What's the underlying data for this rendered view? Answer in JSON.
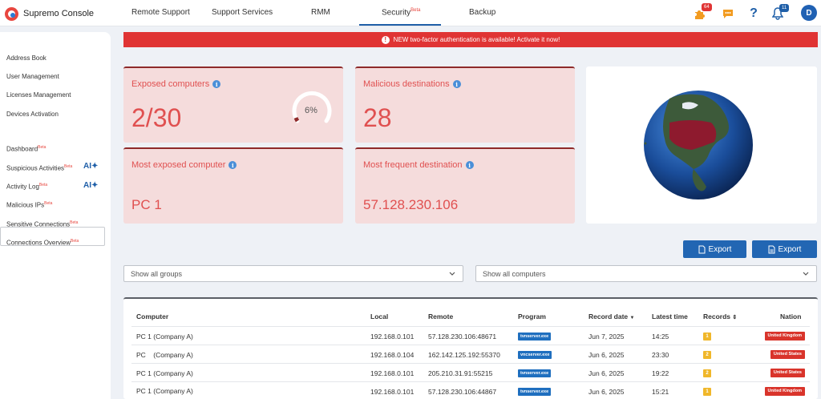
{
  "app": {
    "name": "Supremo Console"
  },
  "nav": {
    "tabs": [
      {
        "label": "Remote Support"
      },
      {
        "label": "Support Services"
      },
      {
        "label": "RMM"
      },
      {
        "label": "Security",
        "badge": "Beta"
      },
      {
        "label": "Backup"
      }
    ],
    "active": "Security"
  },
  "toolbar": {
    "addons_count": "64",
    "notifications_count": "11",
    "help": "?",
    "avatar": "D"
  },
  "sidebar": {
    "items": [
      {
        "label": "Address Book"
      },
      {
        "label": "User Management"
      },
      {
        "label": "Licenses Management"
      },
      {
        "label": "Devices Activation"
      },
      {
        "label": "Dashboard",
        "badge": "Beta"
      },
      {
        "label": "Suspicious Activities",
        "badge": "Beta",
        "ai": "AI"
      },
      {
        "label": "Activity Log",
        "badge": "Beta",
        "ai": "AI"
      },
      {
        "label": "Malicious IPs",
        "badge": "Beta"
      },
      {
        "label": "Sensitive Connections",
        "badge": "Beta"
      },
      {
        "label": "Connections Overview",
        "badge": "Beta"
      }
    ],
    "active": "Malicious IPs"
  },
  "banner": {
    "text": "NEW two-factor authentication is available! Activate it now!",
    "icon": "!"
  },
  "cards": {
    "exposed": {
      "title": "Exposed computers",
      "value": "2/30",
      "gauge_label": "6%",
      "gauge_fraction": 0.06
    },
    "malicious": {
      "title": "Malicious destinations",
      "value": "28"
    },
    "most_exposed": {
      "title": "Most exposed computer",
      "value": "PC 1"
    },
    "most_frequent": {
      "title": "Most frequent destination",
      "value": "57.128.230.106"
    }
  },
  "exports": {
    "label1": "Export",
    "label2": "Export"
  },
  "filters": {
    "groups": "Show all groups",
    "computers": "Show all computers"
  },
  "table": {
    "headers": {
      "computer": "Computer",
      "local": "Local",
      "remote": "Remote",
      "program": "Program",
      "record_date": "Record date",
      "latest_time": "Latest time",
      "records": "Records",
      "nation": "Nation"
    },
    "rows": [
      {
        "computer": "PC 1 (Company A)",
        "local": "192.168.0.101",
        "remote": "57.128.230.106:48671",
        "program": "tvnserver.exe",
        "date": "Jun 7, 2025",
        "time": "14:25",
        "records": "1",
        "nation": "United Kingdom"
      },
      {
        "computer": "PC    (Company A)",
        "local": "192.168.0.104",
        "remote": "162.142.125.192:55370",
        "program": "vncserver.exe",
        "date": "Jun 6, 2025",
        "time": "23:30",
        "records": "2",
        "nation": "United States"
      },
      {
        "computer": "PC 1 (Company A)",
        "local": "192.168.0.101",
        "remote": "205.210.31.91:55215",
        "program": "tvnserver.exe",
        "date": "Jun 6, 2025",
        "time": "19:22",
        "records": "2",
        "nation": "United States"
      },
      {
        "computer": "PC 1 (Company A)",
        "local": "192.168.0.101",
        "remote": "57.128.230.106:44867",
        "program": "tvnserver.exe",
        "date": "Jun 6, 2025",
        "time": "15:21",
        "records": "1",
        "nation": "United Kingdom"
      }
    ]
  },
  "colors": {
    "accent": "#2266b3",
    "danger": "#e03434",
    "card": "#f5dcdc",
    "records": "#f0b72a"
  }
}
